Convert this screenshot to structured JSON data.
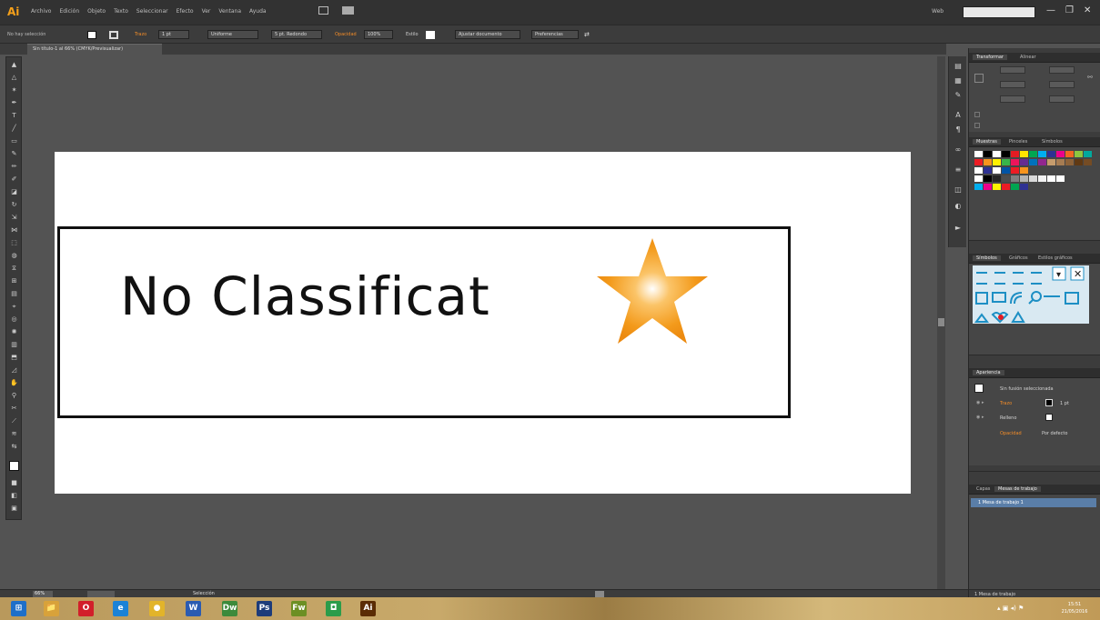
{
  "app": {
    "logo": "Ai",
    "menus": [
      "Archivo",
      "Edición",
      "Objeto",
      "Texto",
      "Seleccionar",
      "Efecto",
      "Ver",
      "Ventana",
      "Ayuda"
    ],
    "workspace": "Web",
    "window_controls": [
      "—",
      "❐",
      "✕"
    ]
  },
  "control_bar": {
    "selection_label": "No hay selección",
    "stroke_label": "Trazo",
    "stroke_value": "1 pt",
    "brush_value": "Uniforme",
    "style_value": "5 pt. Redondo",
    "opacity_label": "Opacidad",
    "opacity_value": "100%",
    "style_label": "Estilo",
    "doc_setup_button": "Ajustar documento",
    "prefs_button": "Preferencias"
  },
  "document": {
    "tab_title": "Sin título-1 al 66% (CMYK/Previsualizar)",
    "label_text": "No Classificat"
  },
  "panels": {
    "transform_tabs": [
      "Transformar",
      "Alinear"
    ],
    "swatches_tabs": [
      "Muestras",
      "Pinceles",
      "Símbolos"
    ],
    "symbols_tabs": [
      "Símbolos",
      "Gráficos",
      "Estilos gráficos"
    ],
    "appearance_tab": "Apariencia",
    "appearance_title": "Sin fusión seleccionada",
    "appearance_rows": [
      {
        "label": "Trazo",
        "value": "1 pt"
      },
      {
        "label": "Relleno",
        "value": ""
      },
      {
        "label": "Opacidad",
        "value": "Por defecto"
      }
    ],
    "layers_tabs": [
      "Capas",
      "Mesas de trabajo"
    ],
    "artboard_row": "1  Mesa de trabajo 1",
    "layers_footer": "1 Mesa de trabajo"
  },
  "status_bar": {
    "zoom": "66%",
    "selection": "Selección"
  },
  "taskbar": {
    "apps": [
      {
        "name": "windows",
        "glyph": "⊞",
        "color": "#1e6fc9"
      },
      {
        "name": "explorer",
        "glyph": "📁",
        "color": "#d8a23a"
      },
      {
        "name": "opera",
        "glyph": "O",
        "color": "#d21f2a"
      },
      {
        "name": "ie",
        "glyph": "e",
        "color": "#1b82d6"
      },
      {
        "name": "chrome",
        "glyph": "●",
        "color": "#e2b42a"
      },
      {
        "name": "word",
        "glyph": "W",
        "color": "#2a5bb1"
      },
      {
        "name": "dreamweaver",
        "glyph": "Dw",
        "color": "#3d8a3b"
      },
      {
        "name": "photoshop",
        "glyph": "Ps",
        "color": "#1d3c7a"
      },
      {
        "name": "fireworks",
        "glyph": "Fw",
        "color": "#6c8f24"
      },
      {
        "name": "app",
        "glyph": "◘",
        "color": "#2b9c4a"
      },
      {
        "name": "illustrator",
        "glyph": "Ai",
        "color": "#5b2c05"
      }
    ],
    "clock_time": "15:51",
    "clock_date": "21/05/2016"
  }
}
